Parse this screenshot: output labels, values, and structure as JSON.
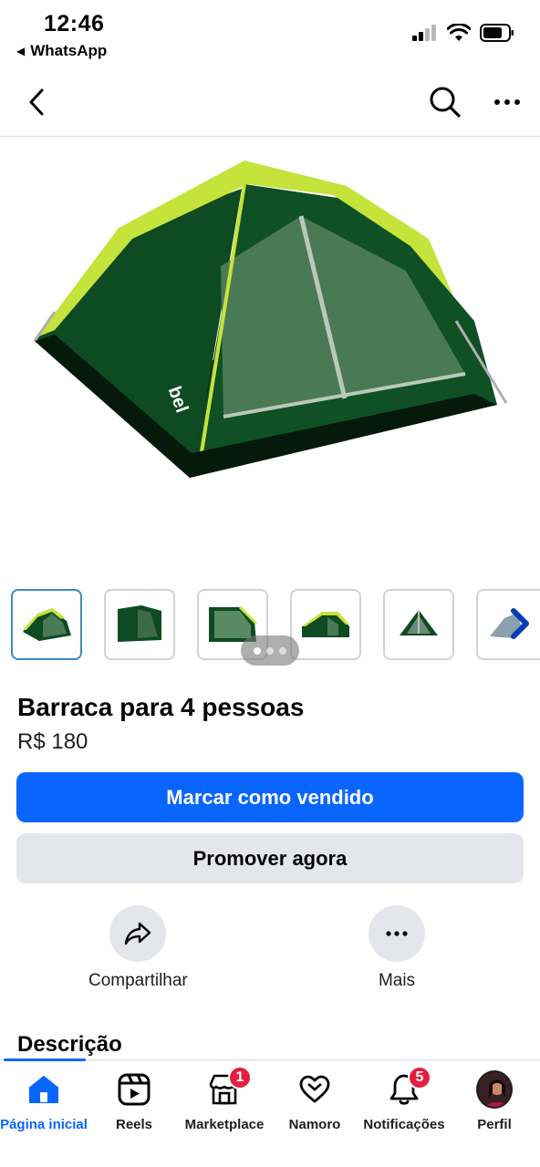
{
  "status_bar": {
    "time": "12:46",
    "back_app": "WhatsApp"
  },
  "nav": {
    "back_icon": "chevron-left-icon",
    "search_icon": "search-icon",
    "more_icon": "more-horizontal-icon"
  },
  "product": {
    "title": "Barraca para 4 pessoas",
    "price": "R$ 180",
    "image_logo": "bel",
    "thumbnails_count": 6
  },
  "buttons": {
    "primary_label": "Marcar como vendido",
    "secondary_label": "Promover agora"
  },
  "actions": {
    "share_label": "Compartilhar",
    "more_label": "Mais"
  },
  "sections": {
    "description_heading": "Descrição"
  },
  "tabs": [
    {
      "label": "Página inicial",
      "icon": "home-icon",
      "active": true
    },
    {
      "label": "Reels",
      "icon": "reels-icon"
    },
    {
      "label": "Marketplace",
      "icon": "marketplace-icon",
      "badge": "1"
    },
    {
      "label": "Namoro",
      "icon": "heart-icon"
    },
    {
      "label": "Notificações",
      "icon": "bell-icon",
      "badge": "5"
    },
    {
      "label": "Perfil",
      "icon": "avatar"
    }
  ],
  "colors": {
    "primary": "#0866ff",
    "secondary_bg": "#e4e6eb",
    "badge": "#e41e3f",
    "tent_green": "#0f4a1e",
    "tent_yellow": "#c8e63a"
  }
}
